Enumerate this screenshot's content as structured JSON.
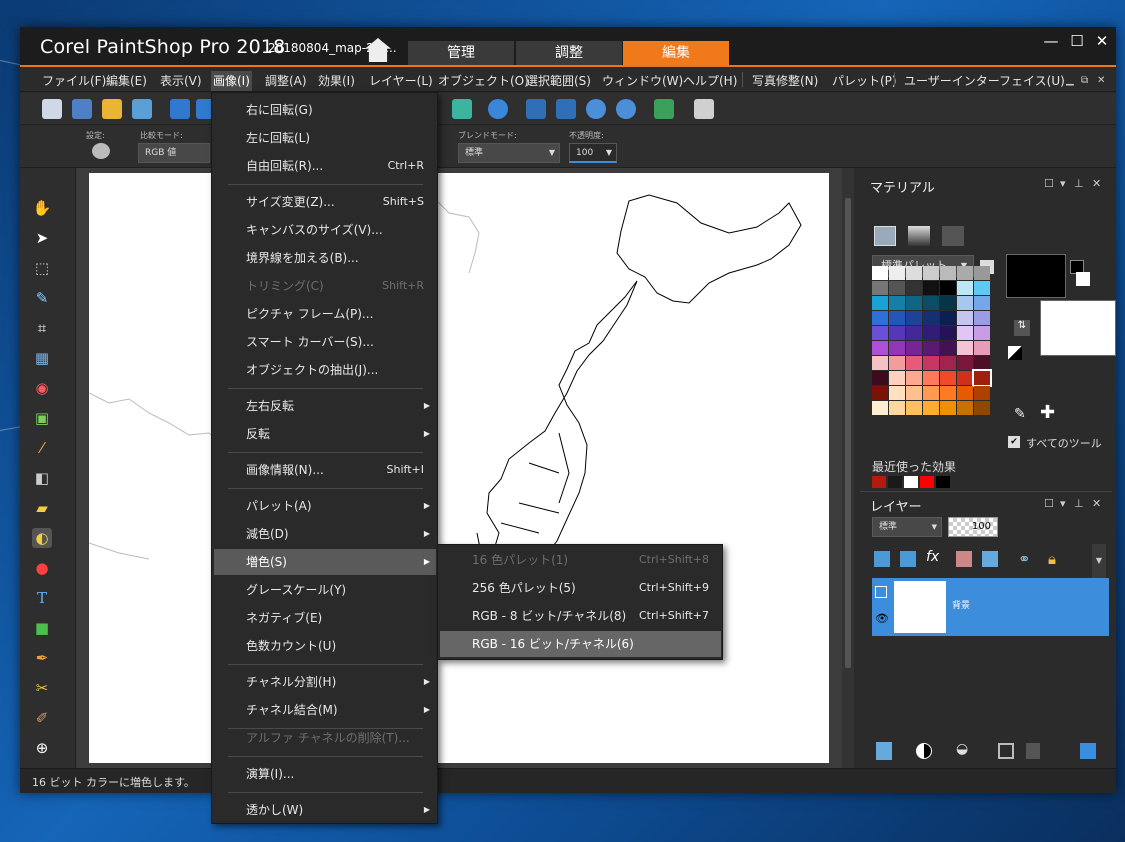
{
  "app": {
    "title": "Corel PaintShop Pro 2018",
    "document": "20180804_map-2.p...",
    "workspace_tabs": [
      "管理",
      "調整",
      "編集"
    ],
    "active_tab": "編集"
  },
  "menubar": [
    "ファイル(F)",
    "編集(E)",
    "表示(V)",
    "画像(I)",
    "調整(A)",
    "効果(I)",
    "レイヤー(L)",
    "オブジェクト(O)",
    "選択範囲(S)",
    "ウィンドウ(W)",
    "ヘルプ(H)",
    "写真修整(N)",
    "パレット(P)",
    "ユーザーインターフェイス(U)"
  ],
  "options": {
    "settings_label": "設定:",
    "compare_label": "比較モード:",
    "compare_value": "RGB 値",
    "blend_label": "ブレンドモード:",
    "blend_value": "標準",
    "opacity_label": "不透明度:",
    "opacity_value": "100"
  },
  "image_menu": {
    "items": [
      {
        "label": "右に回転(G)",
        "shortcut": "",
        "disabled": false
      },
      {
        "label": "左に回転(L)",
        "shortcut": "",
        "disabled": false
      },
      {
        "label": "自由回転(R)...",
        "shortcut": "Ctrl+R",
        "disabled": false
      },
      {
        "label": "サイズ変更(Z)...",
        "shortcut": "Shift+S",
        "disabled": false
      },
      {
        "label": "キャンバスのサイズ(V)...",
        "shortcut": "",
        "disabled": false
      },
      {
        "label": "境界線を加える(B)...",
        "shortcut": "",
        "disabled": false
      },
      {
        "label": "トリミング(C)",
        "shortcut": "Shift+R",
        "disabled": true
      },
      {
        "label": "ピクチャ フレーム(P)...",
        "shortcut": "",
        "disabled": false
      },
      {
        "label": "スマート カーバー(S)...",
        "shortcut": "",
        "disabled": false
      },
      {
        "label": "オブジェクトの抽出(J)...",
        "shortcut": "",
        "disabled": false
      },
      {
        "label": "左右反転",
        "shortcut": "",
        "disabled": false
      },
      {
        "label": "反転",
        "shortcut": "",
        "disabled": false
      },
      {
        "label": "画像情報(N)...",
        "shortcut": "Shift+I",
        "disabled": false
      },
      {
        "label": "パレット(A)",
        "shortcut": "",
        "disabled": false
      },
      {
        "label": "減色(D)",
        "shortcut": "",
        "disabled": false
      },
      {
        "label": "増色(S)",
        "shortcut": "",
        "disabled": false
      },
      {
        "label": "グレースケール(Y)",
        "shortcut": "",
        "disabled": false
      },
      {
        "label": "ネガティブ(E)",
        "shortcut": "",
        "disabled": false
      },
      {
        "label": "色数カウント(U)",
        "shortcut": "",
        "disabled": false
      },
      {
        "label": "チャネル分割(H)",
        "shortcut": "",
        "disabled": false
      },
      {
        "label": "チャネル結合(M)",
        "shortcut": "",
        "disabled": false
      },
      {
        "label": "アルファ チャネルの削除(T)...",
        "shortcut": "",
        "disabled": true
      },
      {
        "label": "演算(I)...",
        "shortcut": "",
        "disabled": false
      },
      {
        "label": "透かし(W)",
        "shortcut": "",
        "disabled": false
      }
    ]
  },
  "increase_color_submenu": {
    "items": [
      {
        "label": "16 色パレット(1)",
        "shortcut": "Ctrl+Shift+8",
        "disabled": true
      },
      {
        "label": "256 色パレット(5)",
        "shortcut": "Ctrl+Shift+9",
        "disabled": false
      },
      {
        "label": "RGB - 8 ビット/チャネル(8)",
        "shortcut": "Ctrl+Shift+7",
        "disabled": false
      },
      {
        "label": "RGB - 16 ビット/チャネル(6)",
        "shortcut": "",
        "disabled": false
      }
    ]
  },
  "materials": {
    "title": "マテリアル",
    "palette_select": "標準パレット",
    "recent_effects_label": "最近使った効果",
    "all_tools_label": "すべてのツール",
    "all_tools_checked": true,
    "foreground": "#000000",
    "background": "#ffffff"
  },
  "layers": {
    "title": "レイヤー",
    "blend": "標準",
    "opacity": "100",
    "layer_name": "背景"
  },
  "status": "16 ビット カラーに増色します。"
}
